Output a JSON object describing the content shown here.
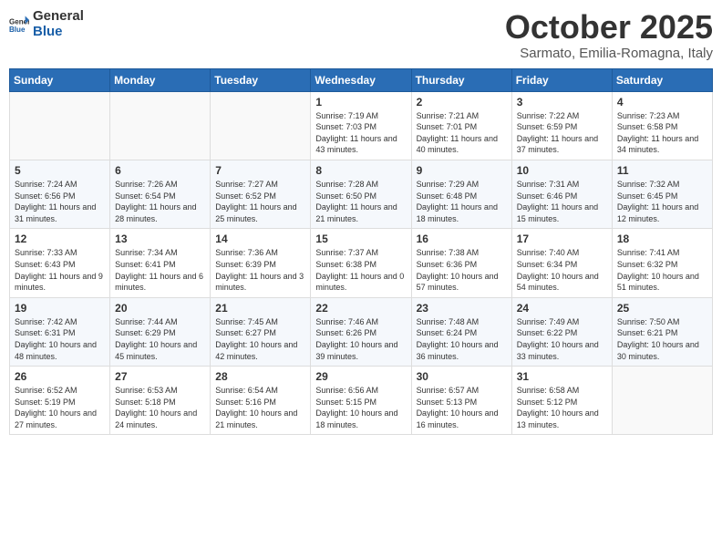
{
  "header": {
    "logo_general": "General",
    "logo_blue": "Blue",
    "month_title": "October 2025",
    "location": "Sarmato, Emilia-Romagna, Italy"
  },
  "days_of_week": [
    "Sunday",
    "Monday",
    "Tuesday",
    "Wednesday",
    "Thursday",
    "Friday",
    "Saturday"
  ],
  "weeks": [
    [
      {
        "day": "",
        "info": ""
      },
      {
        "day": "",
        "info": ""
      },
      {
        "day": "",
        "info": ""
      },
      {
        "day": "1",
        "info": "Sunrise: 7:19 AM\nSunset: 7:03 PM\nDaylight: 11 hours and 43 minutes."
      },
      {
        "day": "2",
        "info": "Sunrise: 7:21 AM\nSunset: 7:01 PM\nDaylight: 11 hours and 40 minutes."
      },
      {
        "day": "3",
        "info": "Sunrise: 7:22 AM\nSunset: 6:59 PM\nDaylight: 11 hours and 37 minutes."
      },
      {
        "day": "4",
        "info": "Sunrise: 7:23 AM\nSunset: 6:58 PM\nDaylight: 11 hours and 34 minutes."
      }
    ],
    [
      {
        "day": "5",
        "info": "Sunrise: 7:24 AM\nSunset: 6:56 PM\nDaylight: 11 hours and 31 minutes."
      },
      {
        "day": "6",
        "info": "Sunrise: 7:26 AM\nSunset: 6:54 PM\nDaylight: 11 hours and 28 minutes."
      },
      {
        "day": "7",
        "info": "Sunrise: 7:27 AM\nSunset: 6:52 PM\nDaylight: 11 hours and 25 minutes."
      },
      {
        "day": "8",
        "info": "Sunrise: 7:28 AM\nSunset: 6:50 PM\nDaylight: 11 hours and 21 minutes."
      },
      {
        "day": "9",
        "info": "Sunrise: 7:29 AM\nSunset: 6:48 PM\nDaylight: 11 hours and 18 minutes."
      },
      {
        "day": "10",
        "info": "Sunrise: 7:31 AM\nSunset: 6:46 PM\nDaylight: 11 hours and 15 minutes."
      },
      {
        "day": "11",
        "info": "Sunrise: 7:32 AM\nSunset: 6:45 PM\nDaylight: 11 hours and 12 minutes."
      }
    ],
    [
      {
        "day": "12",
        "info": "Sunrise: 7:33 AM\nSunset: 6:43 PM\nDaylight: 11 hours and 9 minutes."
      },
      {
        "day": "13",
        "info": "Sunrise: 7:34 AM\nSunset: 6:41 PM\nDaylight: 11 hours and 6 minutes."
      },
      {
        "day": "14",
        "info": "Sunrise: 7:36 AM\nSunset: 6:39 PM\nDaylight: 11 hours and 3 minutes."
      },
      {
        "day": "15",
        "info": "Sunrise: 7:37 AM\nSunset: 6:38 PM\nDaylight: 11 hours and 0 minutes."
      },
      {
        "day": "16",
        "info": "Sunrise: 7:38 AM\nSunset: 6:36 PM\nDaylight: 10 hours and 57 minutes."
      },
      {
        "day": "17",
        "info": "Sunrise: 7:40 AM\nSunset: 6:34 PM\nDaylight: 10 hours and 54 minutes."
      },
      {
        "day": "18",
        "info": "Sunrise: 7:41 AM\nSunset: 6:32 PM\nDaylight: 10 hours and 51 minutes."
      }
    ],
    [
      {
        "day": "19",
        "info": "Sunrise: 7:42 AM\nSunset: 6:31 PM\nDaylight: 10 hours and 48 minutes."
      },
      {
        "day": "20",
        "info": "Sunrise: 7:44 AM\nSunset: 6:29 PM\nDaylight: 10 hours and 45 minutes."
      },
      {
        "day": "21",
        "info": "Sunrise: 7:45 AM\nSunset: 6:27 PM\nDaylight: 10 hours and 42 minutes."
      },
      {
        "day": "22",
        "info": "Sunrise: 7:46 AM\nSunset: 6:26 PM\nDaylight: 10 hours and 39 minutes."
      },
      {
        "day": "23",
        "info": "Sunrise: 7:48 AM\nSunset: 6:24 PM\nDaylight: 10 hours and 36 minutes."
      },
      {
        "day": "24",
        "info": "Sunrise: 7:49 AM\nSunset: 6:22 PM\nDaylight: 10 hours and 33 minutes."
      },
      {
        "day": "25",
        "info": "Sunrise: 7:50 AM\nSunset: 6:21 PM\nDaylight: 10 hours and 30 minutes."
      }
    ],
    [
      {
        "day": "26",
        "info": "Sunrise: 6:52 AM\nSunset: 5:19 PM\nDaylight: 10 hours and 27 minutes."
      },
      {
        "day": "27",
        "info": "Sunrise: 6:53 AM\nSunset: 5:18 PM\nDaylight: 10 hours and 24 minutes."
      },
      {
        "day": "28",
        "info": "Sunrise: 6:54 AM\nSunset: 5:16 PM\nDaylight: 10 hours and 21 minutes."
      },
      {
        "day": "29",
        "info": "Sunrise: 6:56 AM\nSunset: 5:15 PM\nDaylight: 10 hours and 18 minutes."
      },
      {
        "day": "30",
        "info": "Sunrise: 6:57 AM\nSunset: 5:13 PM\nDaylight: 10 hours and 16 minutes."
      },
      {
        "day": "31",
        "info": "Sunrise: 6:58 AM\nSunset: 5:12 PM\nDaylight: 10 hours and 13 minutes."
      },
      {
        "day": "",
        "info": ""
      }
    ]
  ]
}
